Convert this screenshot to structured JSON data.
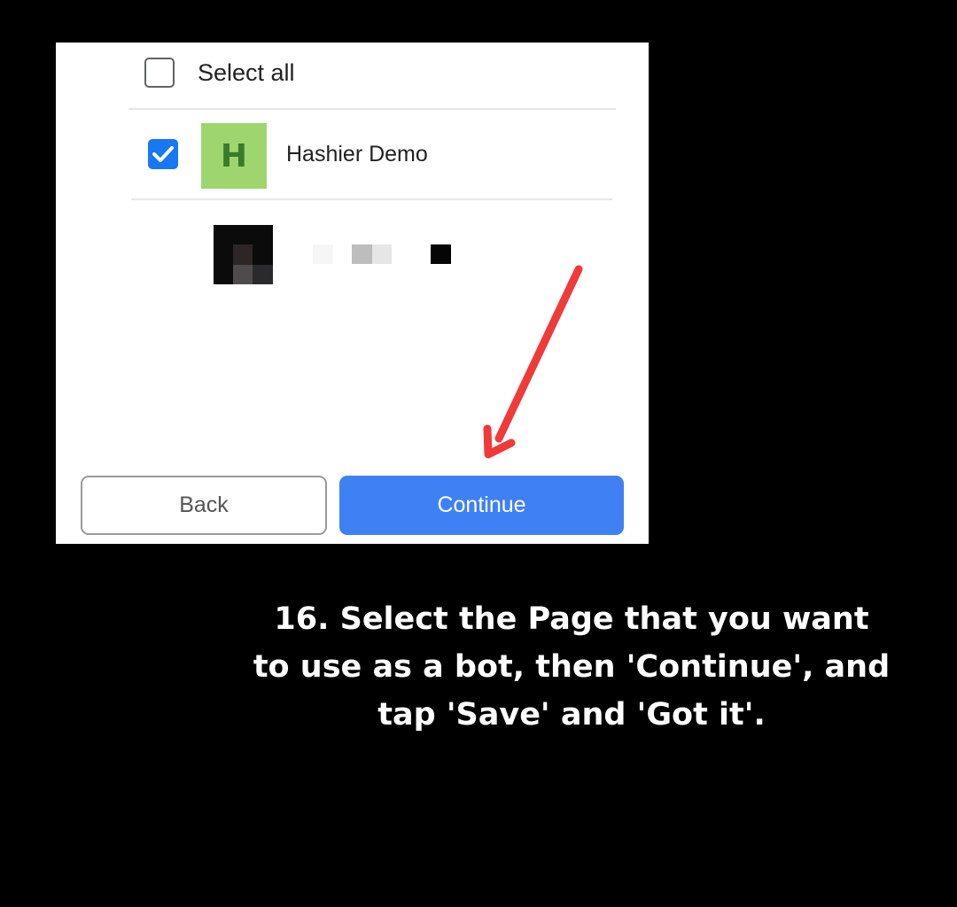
{
  "dialog": {
    "select_all_label": "Select all",
    "select_all_checked": false,
    "pages": [
      {
        "avatar_letter": "H",
        "name": "Hashier Demo",
        "checked": true,
        "avatar_color": "#9ed56f"
      },
      {
        "avatar_letter": "",
        "name": "",
        "checked": false,
        "redacted": true
      }
    ],
    "back_label": "Back",
    "continue_label": "Continue"
  },
  "annotation": {
    "arrow_color": "#f03a3a"
  },
  "caption": {
    "lines": [
      "16. Select the Page that you want",
      "to use as a bot, then 'Continue', and",
      "tap 'Save' and 'Got it'."
    ]
  },
  "colors": {
    "accent": "#4080f5",
    "checkbox_checked": "#1877f2",
    "background": "#000000"
  }
}
